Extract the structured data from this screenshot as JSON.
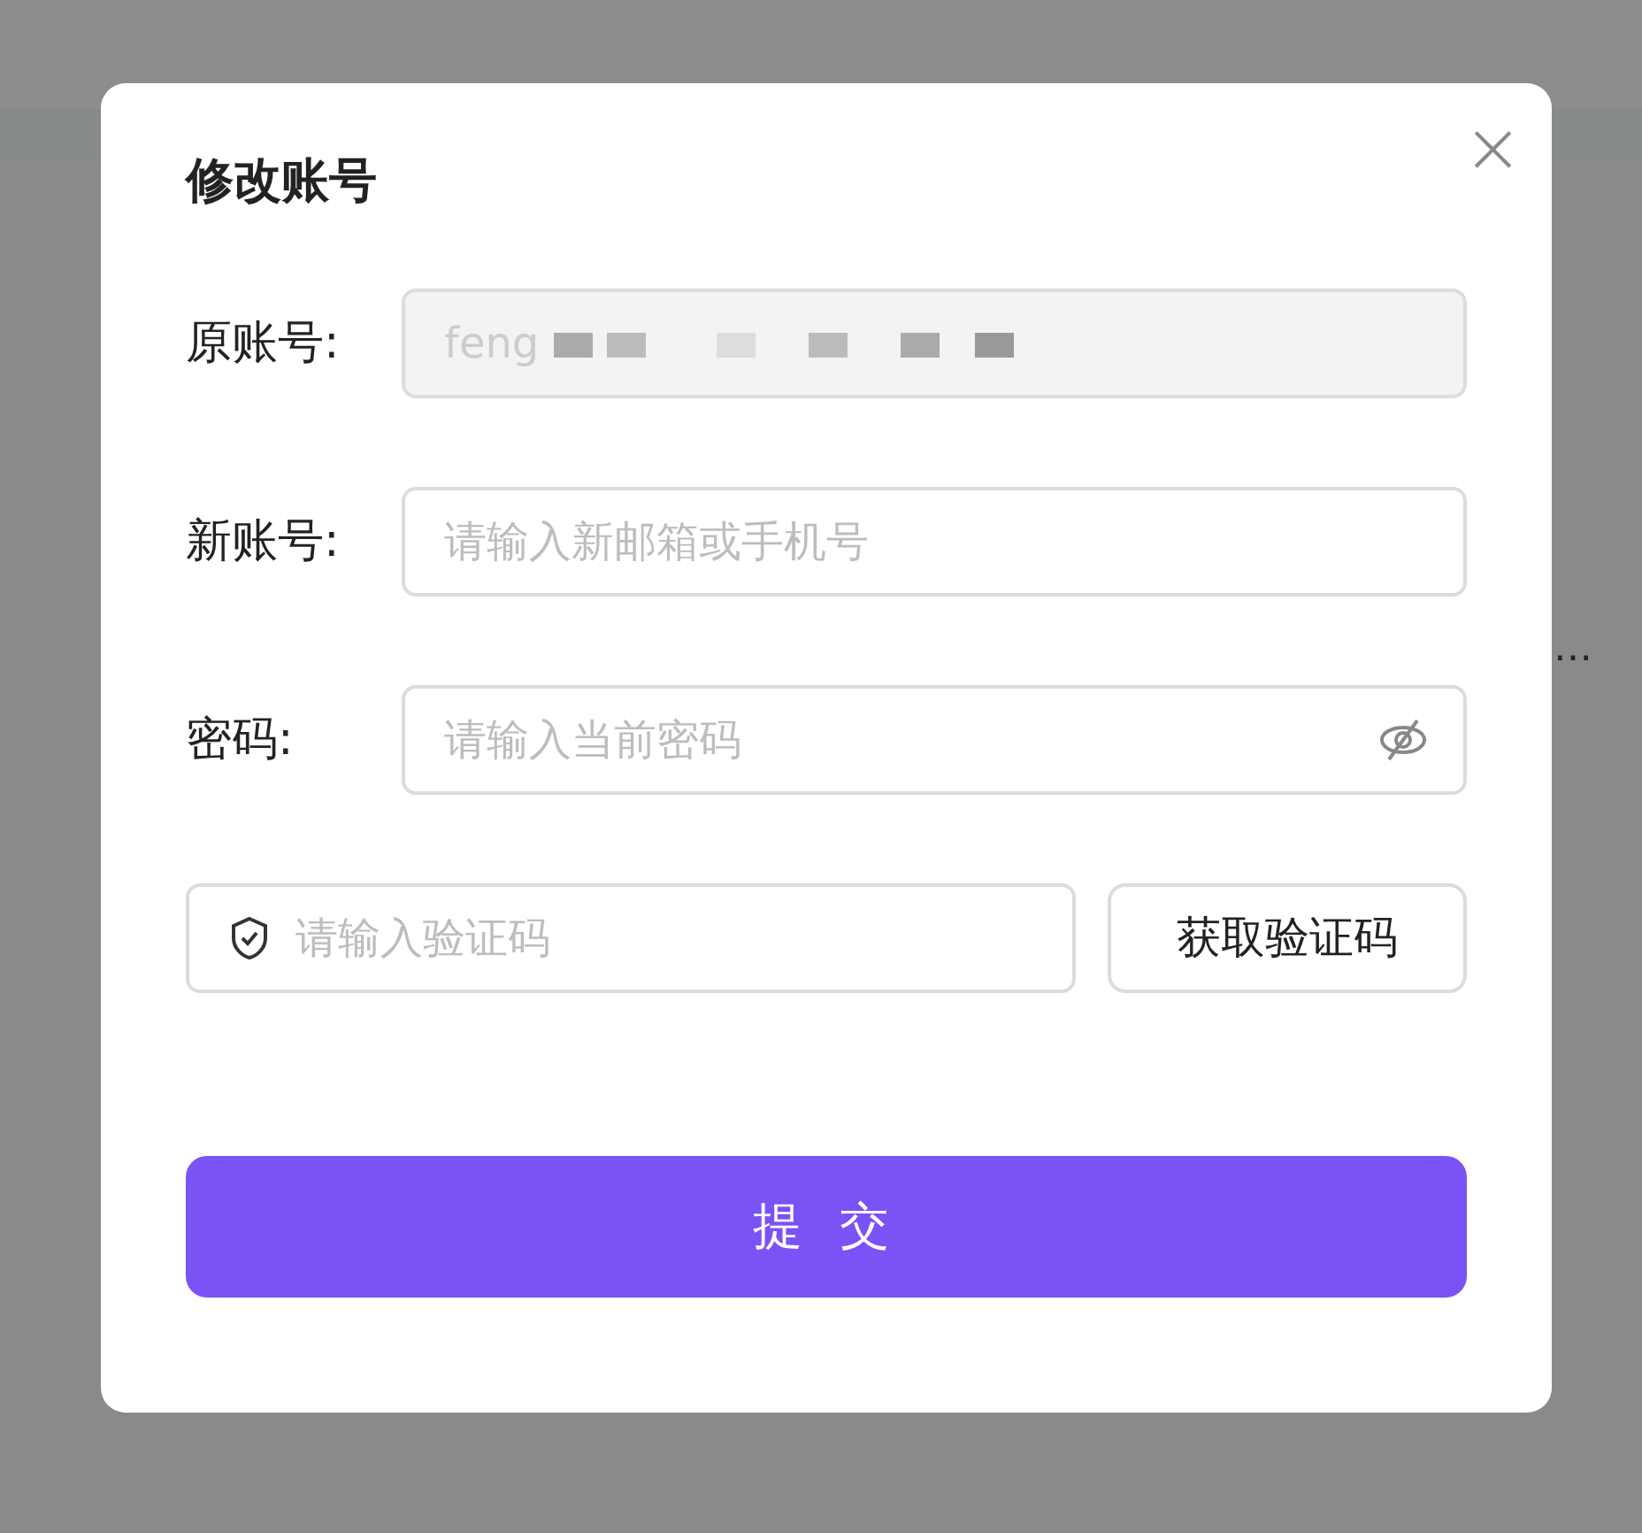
{
  "background": {
    "text": "…"
  },
  "dialog": {
    "title": "修改账号",
    "close": "×",
    "fields": [
      {
        "kind": "readonly",
        "label": "原账号:",
        "value": "feng",
        "redacted": true
      },
      {
        "kind": "text",
        "label": "新账号:",
        "placeholder": "请输入新邮箱或手机号"
      },
      {
        "kind": "password",
        "label": "密码:",
        "placeholder": "请输入当前密码",
        "visible": false
      }
    ],
    "code": {
      "placeholder": "请输入验证码",
      "button": "获取验证码"
    },
    "submit": "提 交"
  }
}
